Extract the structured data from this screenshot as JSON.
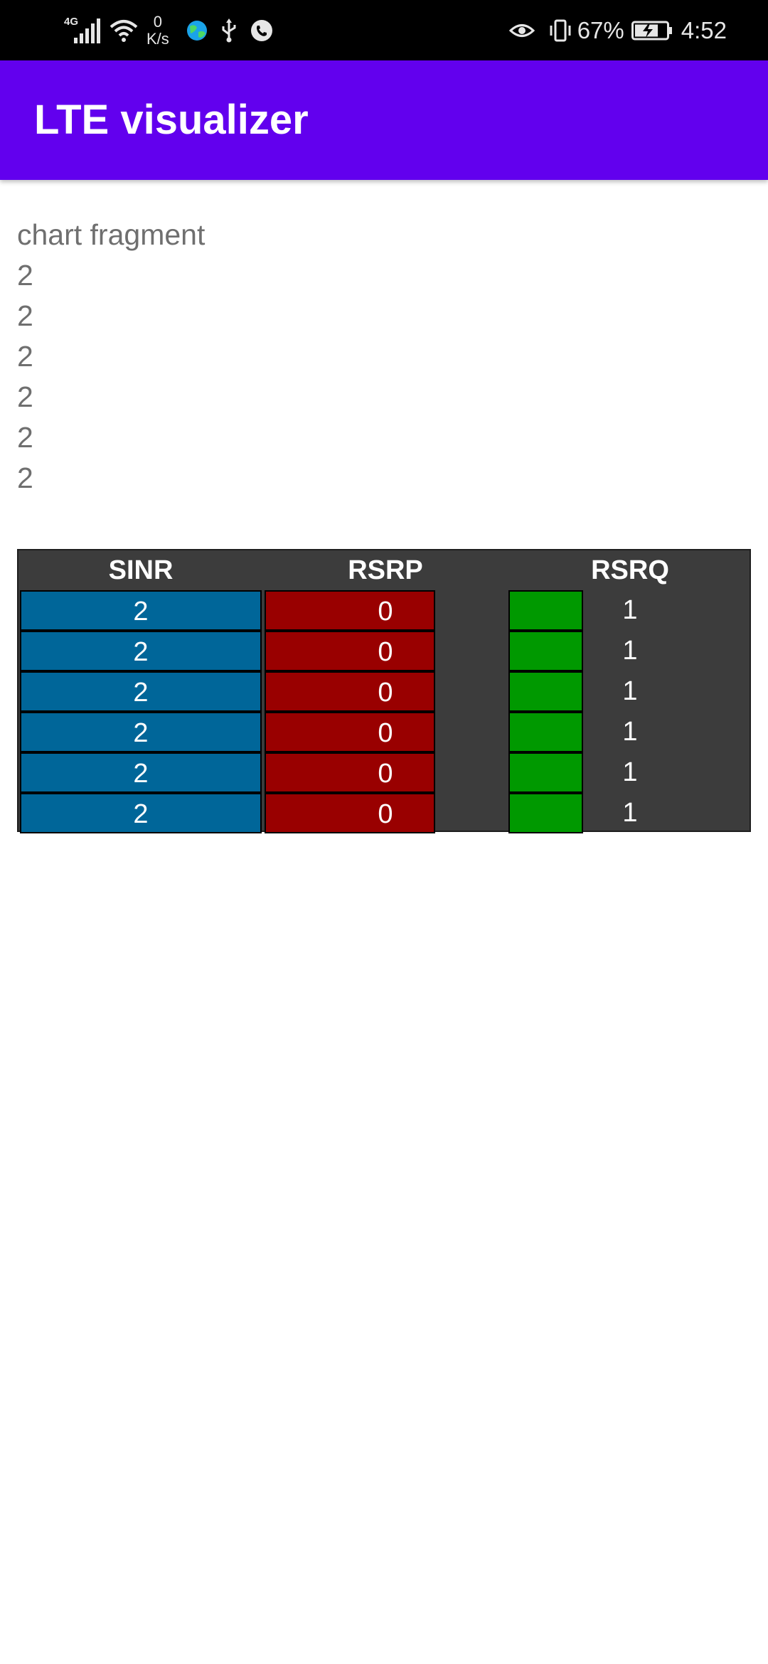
{
  "status_bar": {
    "network_type": "4G",
    "net_speed_value": "0",
    "net_speed_unit": "K/s",
    "battery_percent": "67%",
    "time": "4:52"
  },
  "app_bar": {
    "title": "LTE visualizer"
  },
  "content": {
    "fragment_label": "chart fragment",
    "values": [
      "2",
      "2",
      "2",
      "2",
      "2",
      "2"
    ]
  },
  "signal_table": {
    "headers": {
      "sinr": "SINR",
      "rsrp": "RSRP",
      "rsrq": "RSRQ"
    },
    "rows": [
      {
        "sinr": "2",
        "rsrp": "0",
        "rsrq": "1"
      },
      {
        "sinr": "2",
        "rsrp": "0",
        "rsrq": "1"
      },
      {
        "sinr": "2",
        "rsrp": "0",
        "rsrq": "1"
      },
      {
        "sinr": "2",
        "rsrp": "0",
        "rsrq": "1"
      },
      {
        "sinr": "2",
        "rsrp": "0",
        "rsrq": "1"
      },
      {
        "sinr": "2",
        "rsrp": "0",
        "rsrq": "1"
      }
    ],
    "colors": {
      "sinr": "#006699",
      "rsrp": "#990000",
      "rsrq": "#009900",
      "background": "#3c3c3c"
    }
  },
  "colors": {
    "app_bar": "#6200ee",
    "status_bar": "#000000"
  },
  "icons": {
    "status_left": [
      "signal-bars-icon",
      "wifi-icon",
      "browser-globe-icon",
      "usb-icon",
      "phone-call-icon"
    ],
    "status_right": [
      "eye-comfort-icon",
      "vibrate-icon",
      "battery-charging-icon"
    ]
  }
}
